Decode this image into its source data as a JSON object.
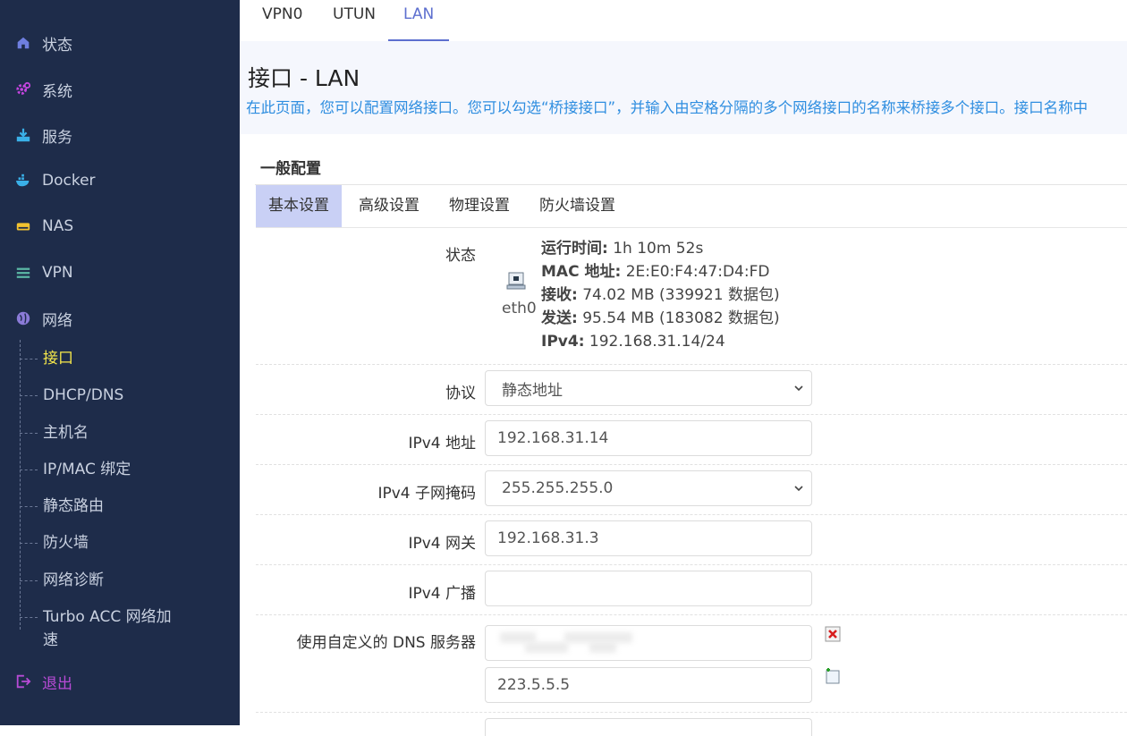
{
  "sidebar": {
    "items": [
      {
        "label": "状态",
        "icon": "home-icon"
      },
      {
        "label": "系统",
        "icon": "gear-icon"
      },
      {
        "label": "服务",
        "icon": "download-icon"
      },
      {
        "label": "Docker",
        "icon": "docker-icon"
      },
      {
        "label": "NAS",
        "icon": "storage-icon"
      },
      {
        "label": "VPN",
        "icon": "list-icon"
      },
      {
        "label": "网络",
        "icon": "globe-icon"
      }
    ],
    "network_subitems": [
      "接口",
      "DHCP/DNS",
      "主机名",
      "IP/MAC 绑定",
      "静态路由",
      "防火墙",
      "网络诊断",
      "Turbo ACC 网络加速"
    ],
    "logout": "退出",
    "active_subitem": "接口",
    "colors": {
      "bg": "#1e2c4a",
      "text": "#c9d1e0",
      "active": "#f6e84a",
      "logout": "#b84bd6",
      "icon": "#c545e0"
    }
  },
  "top_tabs": [
    "VPN0",
    "UTUN",
    "LAN"
  ],
  "active_top_tab": "LAN",
  "header": {
    "title": "接口 - LAN",
    "description": "在此页面，您可以配置网络接口。您可以勾选“桥接接口”，并输入由空格分隔的多个网络接口的名称来桥接多个接口。接口名称中"
  },
  "section": {
    "title": "一般配置",
    "tabs": [
      "基本设置",
      "高级设置",
      "物理设置",
      "防火墙设置"
    ],
    "active_tab": "基本设置"
  },
  "status": {
    "label": "状态",
    "device": "eth0",
    "uptime_label": "运行时间:",
    "uptime": "1h 10m 52s",
    "mac_label": "MAC 地址:",
    "mac": "2E:E0:F4:47:D4:FD",
    "rx_label": "接收:",
    "rx": "74.02 MB (339921 数据包)",
    "tx_label": "发送:",
    "tx": "95.54 MB (183082 数据包)",
    "ipv4_label": "IPv4:",
    "ipv4": "192.168.31.14/24"
  },
  "form": {
    "protocol_label": "协议",
    "protocol_value": "静态地址",
    "ipv4_addr_label": "IPv4 地址",
    "ipv4_addr_value": "192.168.31.14",
    "netmask_label": "IPv4 子网掩码",
    "netmask_value": "255.255.255.0",
    "gateway_label": "IPv4 网关",
    "gateway_value": "192.168.31.3",
    "broadcast_label": "IPv4 广播",
    "broadcast_value": "",
    "dns_label": "使用自定义的 DNS 服务器",
    "dns_values": [
      "",
      "223.5.5.5"
    ]
  }
}
